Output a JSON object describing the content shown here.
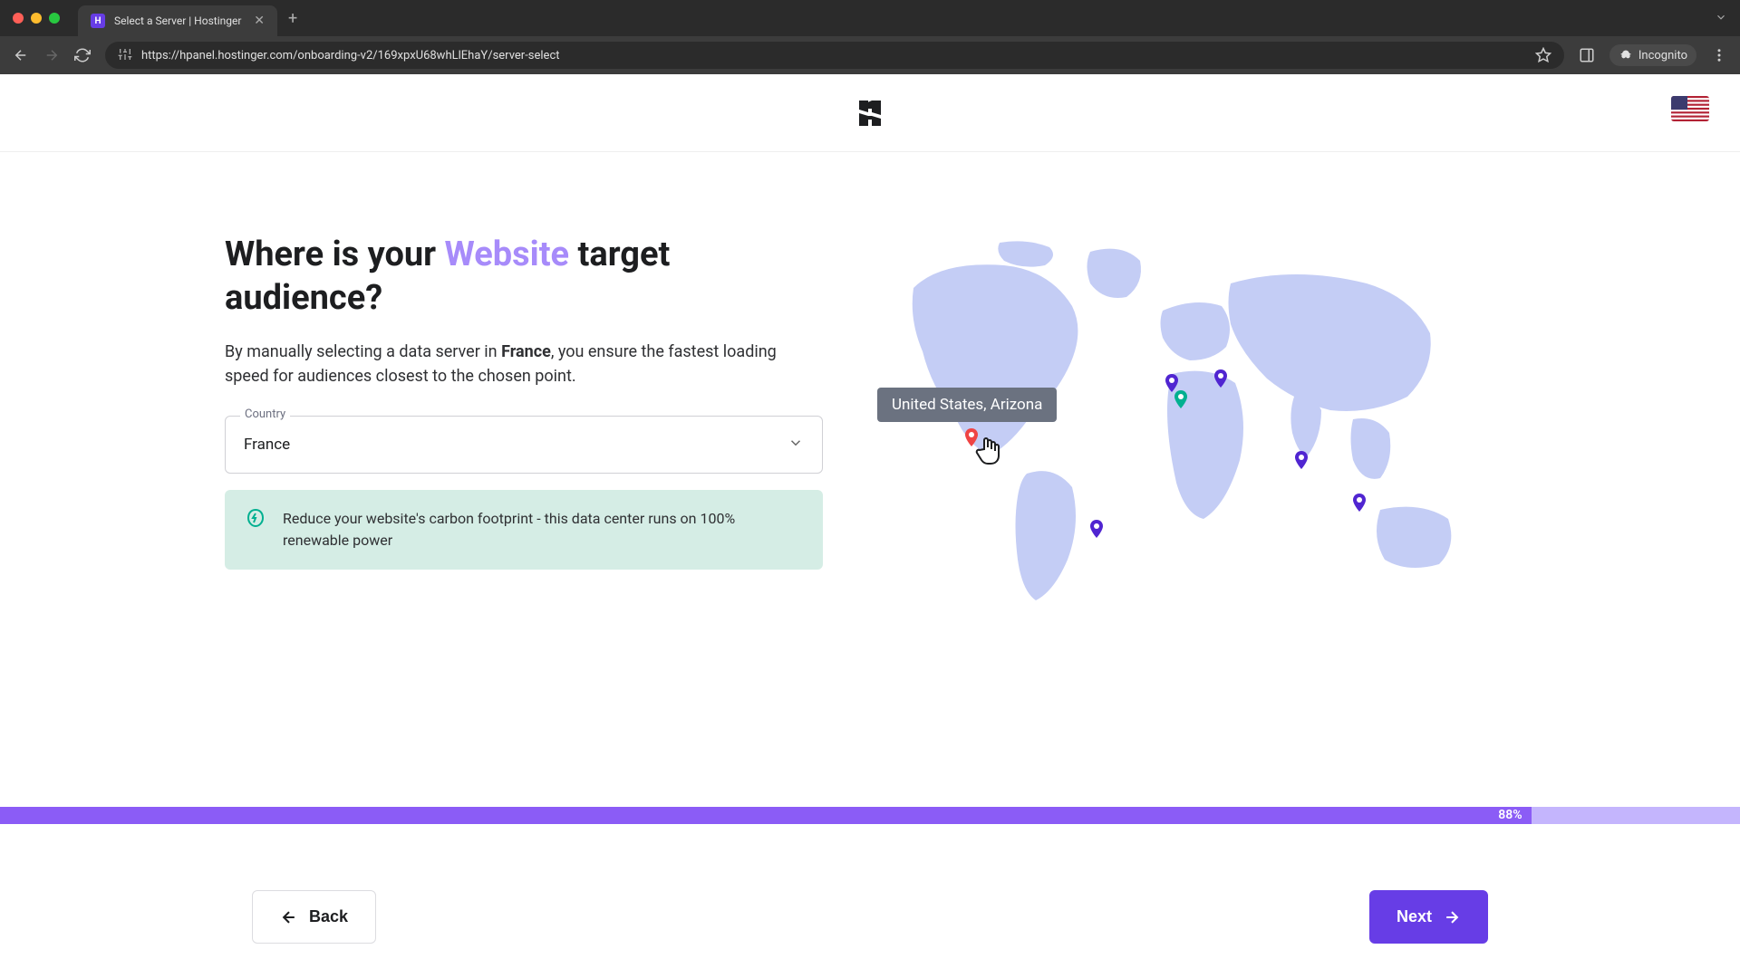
{
  "browser": {
    "tab_title": "Select a Server | Hostinger",
    "url": "https://hpanel.hostinger.com/onboarding-v2/169xpxU68whLlEhaY/server-select",
    "incognito_label": "Incognito"
  },
  "page": {
    "heading_prefix": "Where is your ",
    "heading_highlight": "Website",
    "heading_suffix": " target audience?",
    "subtext_prefix": "By manually selecting a data server in ",
    "subtext_country": "France",
    "subtext_suffix": ", you ensure the fastest loading speed for audiences closest to the chosen point.",
    "select_label": "Country",
    "select_value": "France",
    "eco_message": "Reduce your website's carbon footprint - this data center runs on 100% renewable power",
    "map_tooltip": "United States, Arizona",
    "progress_percent": "88%",
    "back_label": "Back",
    "next_label": "Next"
  },
  "colors": {
    "highlight": "#a78bfa",
    "primary": "#673de6",
    "eco_bg": "#d5ede5",
    "map_land": "#c4cdf5",
    "pin": "#5025d1",
    "pin_selected": "#00b090"
  }
}
